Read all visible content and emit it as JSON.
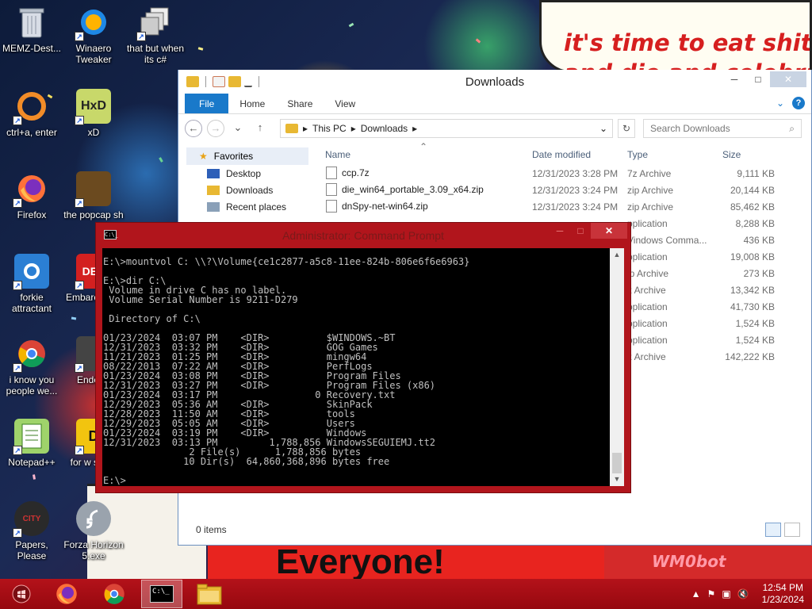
{
  "desktop": {
    "icons": [
      {
        "label": "MEMZ-Dest..."
      },
      {
        "label": "Winaero Tweaker"
      },
      {
        "label": "that but when its c#"
      },
      {
        "label": "ctrl+a, enter"
      },
      {
        "label": "xD"
      },
      {
        "label": "Firefox"
      },
      {
        "label": "the popcap sh"
      },
      {
        "label": "forkie attractant"
      },
      {
        "label": "Embarc Dev-"
      },
      {
        "label": "i know you people we..."
      },
      {
        "label": "Enderm"
      },
      {
        "label": "Notepad++"
      },
      {
        "label": "for w some"
      },
      {
        "label": "Papers, Please"
      },
      {
        "label": "Forza Horizon 5.exe"
      }
    ],
    "icon_texts": {
      "hxd": "HxD",
      "dev": "DEV",
      "d": "D",
      "city": "CITY"
    },
    "wallpaper_text": {
      "speech_line1": "it's time to eat shit",
      "speech_line2": "and die and celebrate",
      "bottom_banner": "Everyone!",
      "bottom_right": "WM0bot"
    }
  },
  "explorer": {
    "title": "Downloads",
    "window_controls": {
      "minimize": "─",
      "maximize": "□",
      "close": "✕"
    },
    "ribbon_tabs": [
      "File",
      "Home",
      "Share",
      "View"
    ],
    "ribbon_expand": "⌄",
    "help": "?",
    "nav": {
      "back": "←",
      "forward": "→",
      "recent": "⌄",
      "up": "↑"
    },
    "address": {
      "parts": [
        "This PC",
        "Downloads"
      ],
      "separator": "▸",
      "dropdown": "⌄",
      "refresh": "↻"
    },
    "search": {
      "placeholder": "Search Downloads",
      "icon": "⌕"
    },
    "navpane": {
      "favorites": "Favorites",
      "favorites_icon": "★",
      "items": [
        "Desktop",
        "Downloads",
        "Recent places"
      ]
    },
    "columns": {
      "name": "Name",
      "sort_indicator": "⌃",
      "date": "Date modified",
      "type": "Type",
      "size": "Size"
    },
    "files": [
      {
        "name": "ccp.7z",
        "date": "12/31/2023 3:28 PM",
        "type": "7z Archive",
        "size": "9,111 KB"
      },
      {
        "name": "die_win64_portable_3.09_x64.zip",
        "date": "12/31/2023 3:24 PM",
        "type": "zip Archive",
        "size": "20,144 KB"
      },
      {
        "name": "dnSpy-net-win64.zip",
        "date": "12/31/2023 3:24 PM",
        "type": "zip Archive",
        "size": "85,462 KB"
      },
      {
        "name": "",
        "date": "",
        "type": "pplication",
        "size": "8,288 KB"
      },
      {
        "name": "",
        "date": "",
        "type": "Vindows Comma...",
        "size": "436 KB"
      },
      {
        "name": "",
        "date": "",
        "type": "pplication",
        "size": "19,008 KB"
      },
      {
        "name": "",
        "date": "",
        "type": "ip Archive",
        "size": "273 KB"
      },
      {
        "name": "",
        "date": "",
        "type": "z Archive",
        "size": "13,342 KB"
      },
      {
        "name": "",
        "date": "",
        "type": "pplication",
        "size": "41,730 KB"
      },
      {
        "name": "",
        "date": "",
        "type": "pplication",
        "size": "1,524 KB"
      },
      {
        "name": "",
        "date": "",
        "type": "pplication",
        "size": "1,524 KB"
      },
      {
        "name": "",
        "date": "",
        "type": "z Archive",
        "size": "142,222 KB"
      }
    ],
    "status": "0 items"
  },
  "cmd": {
    "title": "Administrator: Command Prompt",
    "icon_text": "C:\\_",
    "window_controls": {
      "minimize": "─",
      "maximize": "□",
      "close": "✕"
    },
    "scroll": {
      "up": "▲",
      "down": "▼"
    },
    "output": "E:\\>mountvol C: \\\\?\\Volume{ce1c2877-a5c8-11ee-824b-806e6f6e6963}\n\nE:\\>dir C:\\\n Volume in drive C has no label.\n Volume Serial Number is 9211-D279\n\n Directory of C:\\\n\n01/23/2024  03:07 PM    <DIR>          $WINDOWS.~BT\n12/31/2023  03:32 PM    <DIR>          GOG Games\n11/21/2023  01:25 PM    <DIR>          mingw64\n08/22/2013  07:22 AM    <DIR>          PerfLogs\n01/23/2024  03:08 PM    <DIR>          Program Files\n12/31/2023  03:27 PM    <DIR>          Program Files (x86)\n01/23/2024  03:17 PM                 0 Recovery.txt\n12/29/2023  05:36 AM    <DIR>          SkinPack\n12/28/2023  11:50 AM    <DIR>          tools\n12/29/2023  05:05 AM    <DIR>          Users\n01/23/2024  03:19 PM    <DIR>          Windows\n12/31/2023  03:13 PM         1,788,856 WindowsSEGUIEMJ.tt2\n               2 File(s)      1,788,856 bytes\n              10 Dir(s)  64,860,368,896 bytes free\n\nE:\\>"
  },
  "taskbar": {
    "pinned": [
      "start-orb",
      "firefox",
      "chrome",
      "command-prompt",
      "file-explorer"
    ],
    "cmd_icon_text": "C:\\_",
    "tray": {
      "chevron": "▲",
      "flag": "⚑",
      "network": "▣",
      "volume": "🔇"
    },
    "clock": {
      "time": "12:54 PM",
      "date": "1/23/2024"
    }
  },
  "colors": {
    "taskbar": "#b4121a",
    "cmd_frame": "#b1151c",
    "explorer_accent": "#1979ca",
    "meme_red": "#d61f1f"
  }
}
